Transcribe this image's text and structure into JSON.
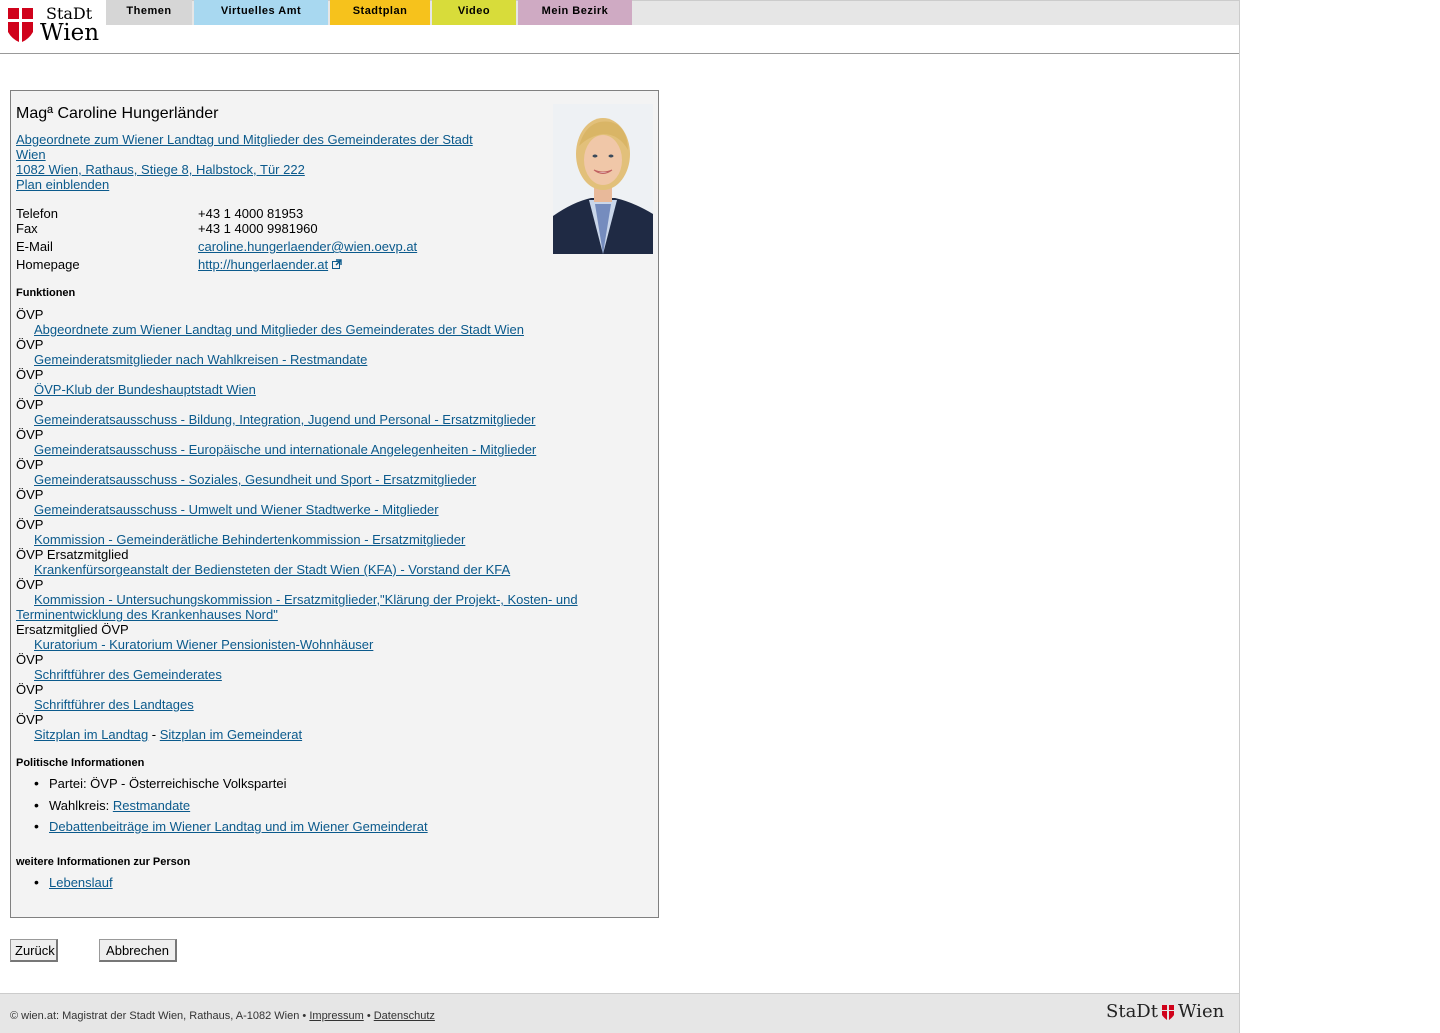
{
  "header": {
    "logo_line1": "StaDt",
    "logo_line2": "Wien",
    "tabs": [
      {
        "label": "Themen",
        "color": "#d6d6d6"
      },
      {
        "label": "Virtuelles Amt",
        "color": "#a8d8f0"
      },
      {
        "label": "Stadtplan",
        "color": "#f6c21c"
      },
      {
        "label": "Video",
        "color": "#d8dc3a"
      },
      {
        "label": "Mein Bezirk",
        "color": "#cfaac3"
      }
    ]
  },
  "person": {
    "name": "Magª Caroline Hungerländer",
    "role_link_line1": "Abgeordnete zum Wiener Landtag und Mitglieder des Gemeinderates der Stadt",
    "role_link_line2": "Wien",
    "address": "1082 Wien, Rathaus, Stiege 8, Halbstock, Tür 222",
    "plan_link": "Plan einblenden",
    "contacts": [
      {
        "label": "Telefon",
        "value": "+43 1 4000 81953"
      },
      {
        "label": "Fax",
        "value": "+43 1 4000 9981960"
      },
      {
        "label": "E-Mail",
        "value": "caroline.hungerlaender@wien.oevp.at"
      },
      {
        "label": "Homepage",
        "value": "http://hungerlaender.at"
      }
    ]
  },
  "funktionen": {
    "heading": "Funktionen",
    "items": [
      {
        "party": "ÖVP",
        "link": "Abgeordnete zum Wiener Landtag und Mitglieder des Gemeinderates der Stadt Wien"
      },
      {
        "party": "ÖVP",
        "link": "Gemeinderatsmitglieder nach Wahlkreisen - Restmandate"
      },
      {
        "party": "ÖVP",
        "link": "ÖVP-Klub der Bundeshauptstadt Wien"
      },
      {
        "party": "ÖVP",
        "link": "Gemeinderatsausschuss - Bildung, Integration, Jugend und Personal - Ersatzmitglieder"
      },
      {
        "party": "ÖVP",
        "link": "Gemeinderatsausschuss - Europäische und internationale Angelegenheiten - Mitglieder"
      },
      {
        "party": "ÖVP",
        "link": "Gemeinderatsausschuss - Soziales, Gesundheit und Sport - Ersatzmitglieder"
      },
      {
        "party": "ÖVP",
        "link": "Gemeinderatsausschuss - Umwelt und Wiener Stadtwerke - Mitglieder"
      },
      {
        "party": "ÖVP",
        "link": "Kommission - Gemeinderätliche Behindertenkommission - Ersatzmitglieder"
      },
      {
        "party": "ÖVP Ersatzmitglied",
        "link": "Krankenfürsorgeanstalt der Bediensteten der Stadt Wien (KFA) - Vorstand der KFA"
      },
      {
        "party": "ÖVP",
        "link_line1": "Kommission - Untersuchungskommission - Ersatzmitglieder,\"Klärung der Projekt-, Kosten- und",
        "link_line2": "Terminentwicklung des Krankenhauses Nord\""
      },
      {
        "party": "Ersatzmitglied ÖVP",
        "link": "Kuratorium - Kuratorium Wiener Pensionisten-Wohnhäuser"
      },
      {
        "party": "ÖVP",
        "link": "Schriftführer des Gemeinderates"
      },
      {
        "party": "ÖVP",
        "link": "Schriftführer des Landtages"
      },
      {
        "party": "ÖVP",
        "link": "Sitzplan im Landtag",
        "separator": " - ",
        "link2": "Sitzplan im Gemeinderat"
      }
    ]
  },
  "politisch": {
    "heading": "Politische Informationen",
    "partei": "Partei: ÖVP - Österreichische Volkspartei",
    "wahlkreis_label": "Wahlkreis:",
    "wahlkreis_link": "Restmandate",
    "debatten_link": "Debattenbeiträge im Wiener Landtag und im Wiener Gemeinderat"
  },
  "weitere": {
    "heading": "weitere Informationen zur Person",
    "lebenslauf": "Lebenslauf"
  },
  "buttons": {
    "back": "Zurück",
    "cancel": "Abbrechen"
  },
  "footer": {
    "text": "© wien.at: Magistrat der Stadt Wien, Rathaus, A-1082 Wien",
    "sep": "•",
    "impressum": "Impressum",
    "datenschutz": "Datenschutz",
    "logo_left": "StaDt",
    "logo_right": "Wien"
  }
}
